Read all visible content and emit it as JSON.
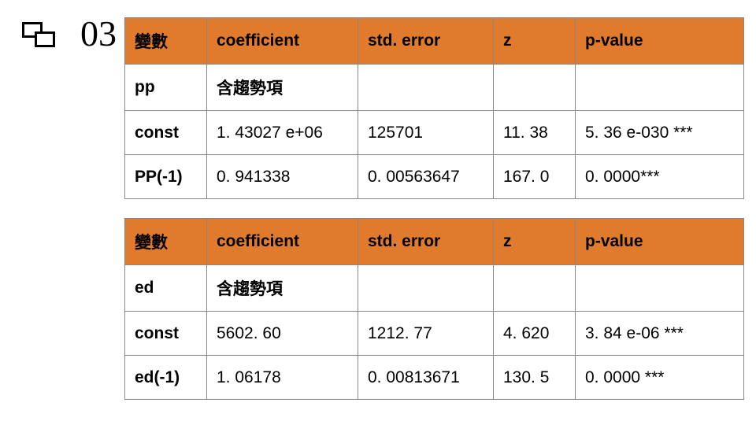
{
  "slide": {
    "section_number": "03"
  },
  "table1": {
    "headers": [
      "變數",
      "coefficient",
      "std. error",
      "z",
      "p-value"
    ],
    "rows": [
      {
        "label": "pp",
        "coefficient": "含趨勢項",
        "stderror": "",
        "z": "",
        "pvalue": ""
      },
      {
        "label": "const",
        "coefficient": "1. 43027 e+06",
        "stderror": "125701",
        "z": "11. 38",
        "pvalue": "5. 36 e-030 ***"
      },
      {
        "label": "PP(-1)",
        "coefficient": "0. 941338",
        "stderror": "0. 00563647",
        "z": "167. 0",
        "pvalue": "0. 0000***"
      }
    ]
  },
  "table2": {
    "headers": [
      "變數",
      "coefficient",
      "std. error",
      "z",
      "p-value"
    ],
    "rows": [
      {
        "label": "ed",
        "coefficient": "含趨勢項",
        "stderror": "",
        "z": "",
        "pvalue": ""
      },
      {
        "label": "const",
        "coefficient": "5602. 60",
        "stderror": "1212. 77",
        "z": "4. 620",
        "pvalue": "3. 84 e-06  ***"
      },
      {
        "label": "ed(-1)",
        "coefficient": "1. 06178",
        "stderror": "0. 00813671",
        "z": "130. 5",
        "pvalue": "0. 0000   ***"
      }
    ]
  }
}
